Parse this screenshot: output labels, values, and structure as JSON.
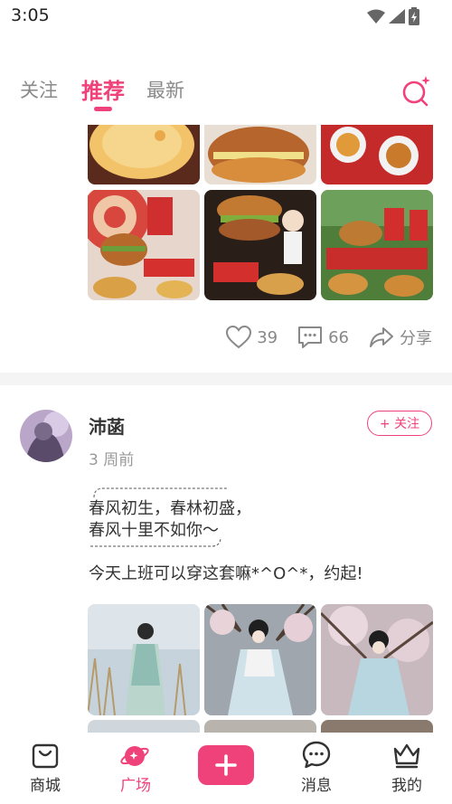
{
  "status_bar": {
    "time": "3:05"
  },
  "top_tabs": [
    {
      "label": "关注",
      "active": false
    },
    {
      "label": "推荐",
      "active": true
    },
    {
      "label": "最新",
      "active": false
    }
  ],
  "first_post": {
    "likes": "39",
    "comments": "66",
    "share_label": "分享"
  },
  "second_post": {
    "username": "沛菡",
    "time_ago": "3 周前",
    "follow_label": "+ 关注",
    "quote_lines": [
      "春风初生，春林初盛，",
      "春风十里不如你～"
    ],
    "body": "今天上班可以穿这套嘛*^O^*，约起!"
  },
  "bottom_nav": [
    {
      "label": "商城",
      "icon": "bag-icon",
      "active": false
    },
    {
      "label": "广场",
      "icon": "planet-icon",
      "active": true
    },
    {
      "label": "",
      "icon": "plus-icon",
      "active": false
    },
    {
      "label": "消息",
      "icon": "chat-bubble-icon",
      "active": false
    },
    {
      "label": "我的",
      "icon": "crown-icon",
      "active": false
    }
  ],
  "colors": {
    "accent": "#f0427a",
    "muted_text": "#8a8a8a",
    "divider": "#f4f4f4"
  }
}
